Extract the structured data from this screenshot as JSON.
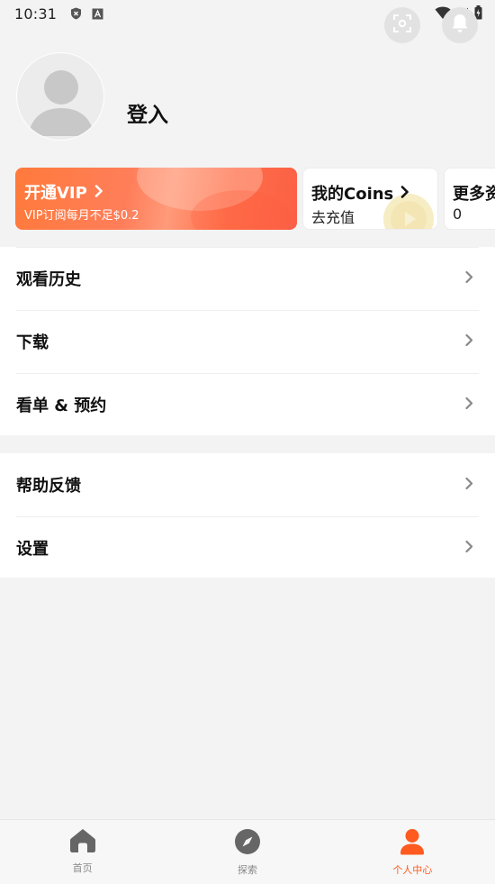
{
  "status_bar": {
    "time": "10:31",
    "left_icons": [
      "shield-x-icon",
      "a-icon"
    ],
    "right_icons": [
      "wifi-icon",
      "signal-icon",
      "battery-icon"
    ]
  },
  "header": {
    "scan_icon": "scan-icon",
    "bell_icon": "bell-icon",
    "login_label": "登入"
  },
  "cards": {
    "vip": {
      "title": "开通VIP",
      "subtitle": "VIP订阅每月不足$0.2"
    },
    "coins": {
      "title": "我的Coins",
      "subtitle": "去充值"
    },
    "more": {
      "title": "更多资",
      "subtitle": "0"
    }
  },
  "menu": {
    "group1": [
      {
        "label": "观看历史"
      },
      {
        "label": "下载"
      },
      {
        "label": "看单 & 预约"
      }
    ],
    "group2": [
      {
        "label": "帮助反馈"
      },
      {
        "label": "设置"
      }
    ]
  },
  "tabbar": {
    "tabs": [
      {
        "label": "首页",
        "icon": "home-icon",
        "active": false
      },
      {
        "label": "探索",
        "icon": "compass-icon",
        "active": false
      },
      {
        "label": "个人中心",
        "icon": "person-icon",
        "active": true
      }
    ]
  },
  "colors": {
    "accent": "#ff5a1f",
    "vip_gradient_start": "#ff7a3b",
    "vip_gradient_end": "#fb5f45",
    "background": "#f3f3f3"
  }
}
